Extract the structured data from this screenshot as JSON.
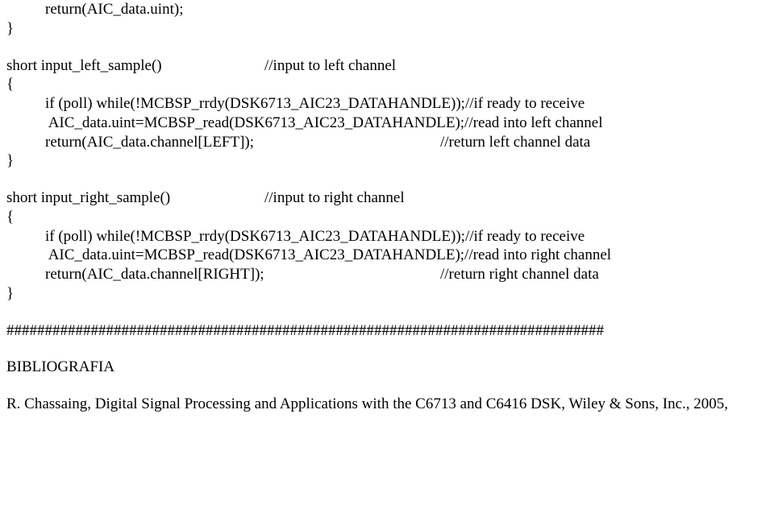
{
  "code": {
    "line1": "return(AIC_data.uint);",
    "line2": "}",
    "fnA_sig": "short input_left_sample()",
    "fnA_comment": "//input to left channel",
    "brace_open": "{",
    "fnA_l1": "if (poll) while(!MCBSP_rrdy(DSK6713_AIC23_DATAHANDLE));//if ready to receive",
    "fnA_l2": " AIC_data.uint=MCBSP_read(DSK6713_AIC23_DATAHANDLE);//read into left channel",
    "fnA_l3a": "return(AIC_data.channel[LEFT]);",
    "fnA_l3b": "//return left channel data",
    "brace_close": "}",
    "fnB_sig": "short input_right_sample()",
    "fnB_comment": "//input to right channel",
    "fnB_l1": "if (poll) while(!MCBSP_rrdy(DSK6713_AIC23_DATAHANDLE));//if ready to receive",
    "fnB_l2": " AIC_data.uint=MCBSP_read(DSK6713_AIC23_DATAHANDLE);//read into right channel",
    "fnB_l3a": "return(AIC_data.channel[RIGHT]);",
    "fnB_l3b": "//return right channel data"
  },
  "divider": "##############################################################################",
  "bibliography_heading": "BIBLIOGRAFIA",
  "reference": "R. Chassaing, Digital Signal Processing and Applications with the C6713 and C6416 DSK, Wiley & Sons, Inc., 2005,"
}
